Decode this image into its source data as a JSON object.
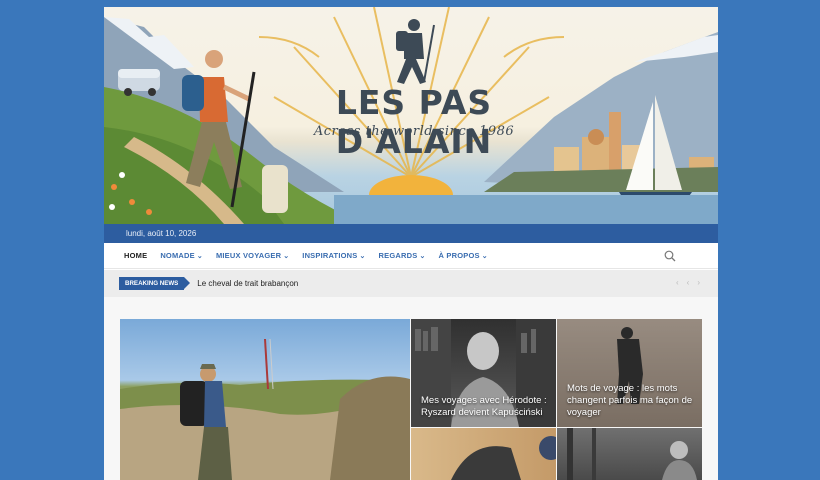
{
  "site": {
    "title": "LES PAS D'ALAIN",
    "tagline": "Across the world since 1986"
  },
  "datebar": {
    "date": "lundi, août 10, 2026"
  },
  "nav": {
    "items": [
      {
        "label": "HOME",
        "active": true,
        "dropdown": false
      },
      {
        "label": "NOMADE",
        "active": false,
        "dropdown": true
      },
      {
        "label": "MIEUX VOYAGER",
        "active": false,
        "dropdown": true
      },
      {
        "label": "INSPIRATIONS",
        "active": false,
        "dropdown": true
      },
      {
        "label": "REGARDS",
        "active": false,
        "dropdown": true
      },
      {
        "label": "À PROPOS",
        "active": false,
        "dropdown": true
      }
    ],
    "chevron": "⌄",
    "search_icon": "search-icon"
  },
  "breaking": {
    "label": "BREAKING NEWS",
    "headline": "Le cheval de trait brabançon",
    "controls": [
      "‹",
      "‹",
      "›"
    ]
  },
  "posts": {
    "tile2_caption": "Mes voyages avec Hérodote : Ryszard devient Kapuściński",
    "tile3_caption": "Mots de voyage : les mots changent parfois ma façon de voyager"
  },
  "colors": {
    "page_bg": "#3a77bb",
    "brand_blue": "#2d5da0",
    "nav_link": "#3a6db0"
  }
}
